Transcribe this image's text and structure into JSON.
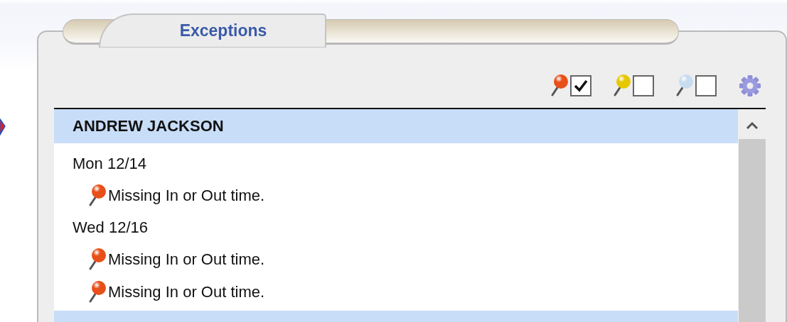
{
  "tab": {
    "label": "Exceptions",
    "selected": true
  },
  "filters": [
    {
      "color": "#e8501a",
      "checked": true
    },
    {
      "color": "#e6c800",
      "checked": false
    },
    {
      "color": "#c8dcf0",
      "checked": false
    }
  ],
  "employees": [
    {
      "name": "ANDREW JACKSON",
      "days": [
        {
          "date": "Mon 12/14",
          "exceptions": [
            {
              "text": "Missing In or Out time.",
              "color": "#e8501a"
            }
          ]
        },
        {
          "date": "Wed 12/16",
          "exceptions": [
            {
              "text": "Missing In or Out time.",
              "color": "#e8501a"
            },
            {
              "text": "Missing In or Out time.",
              "color": "#e8501a"
            }
          ]
        }
      ]
    }
  ]
}
